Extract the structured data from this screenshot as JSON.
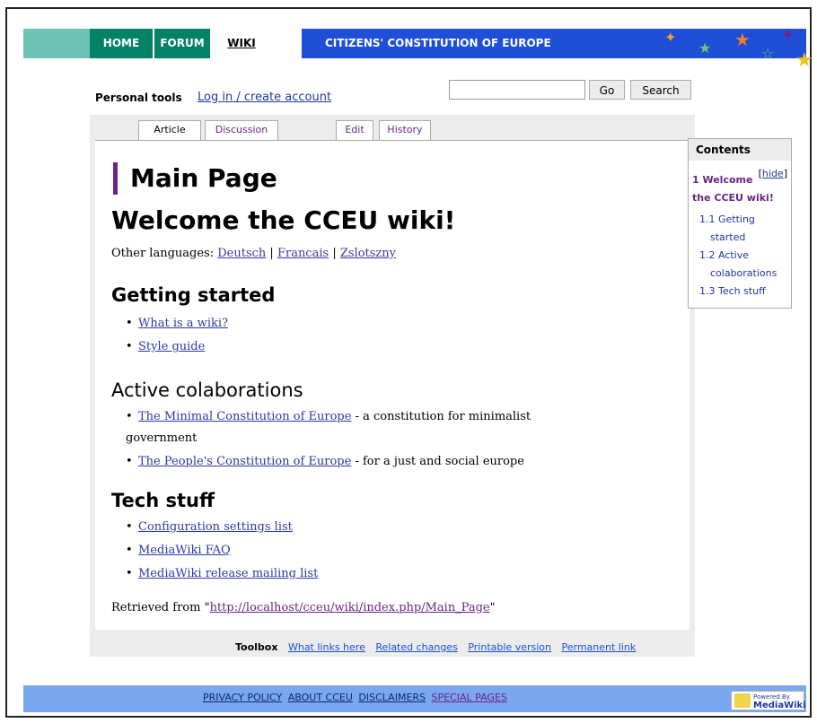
{
  "nav": {
    "home": "HOME",
    "forum": "FORUM",
    "wiki": "WIKI",
    "site_title": "CITIZENS' CONSTITUTION OF EUROPE"
  },
  "personal_tools": {
    "label": "Personal tools",
    "login_link": "Log in / create account"
  },
  "search": {
    "value": "",
    "go_label": "Go",
    "search_label": "Search"
  },
  "tabs": {
    "article": "Article",
    "discussion": "Discussion",
    "edit": "Edit",
    "history": "History"
  },
  "page": {
    "title": "Main Page",
    "heading": "Welcome the CCEU wiki!",
    "other_languages_label": "Other languages:",
    "languages": [
      "Deutsch",
      "Francais",
      "Zslotszny"
    ],
    "sep": "|",
    "sections": {
      "getting_started": {
        "heading": "Getting started",
        "items": [
          "What is a wiki?",
          "Style guide"
        ]
      },
      "active": {
        "heading": "Active colaborations",
        "items": [
          {
            "link": "The Minimal Constitution of Europe",
            "desc": " - a constitution for minimalist",
            "desc_cont": "government"
          },
          {
            "link": "The People's Constitution of Europe",
            "desc": " - for a just and social europe"
          }
        ]
      },
      "tech": {
        "heading": "Tech stuff",
        "items": [
          "Configuration settings list",
          "MediaWiki FAQ",
          "MediaWiki release mailing list"
        ]
      }
    },
    "retrieved_prefix": "Retrieved from \"",
    "retrieved_url": "http://localhost/cceu/wiki/index.php/Main_Page",
    "retrieved_suffix": "\""
  },
  "toc": {
    "title": "Contents",
    "hide_open": "[",
    "hide": "hide",
    "hide_close": "]",
    "l1": "1 Welcome",
    "l1_cont": "the CCEU wiki!",
    "items": [
      {
        "a": "1.1 Getting",
        "b": "started"
      },
      {
        "a": "1.2 Active",
        "b": "colaborations"
      },
      {
        "a": "1.3 Tech stuff",
        "b": ""
      }
    ]
  },
  "toolbox": {
    "label": "Toolbox",
    "links": [
      "What links here",
      "Related changes",
      "Printable version",
      "Permanent link"
    ]
  },
  "footer": {
    "links": [
      "PRIVACY POLICY",
      "ABOUT CCEU",
      "DISCLAIMERS",
      "SPECIAL PAGES"
    ],
    "badge_line1": "Powered By",
    "badge_line2": "MediaWiki"
  },
  "colors": {
    "nav_green": "#048265",
    "banner_blue": "#1f4fd6",
    "footer_blue": "#7aa7f0",
    "accent_purple": "#6b2585"
  }
}
